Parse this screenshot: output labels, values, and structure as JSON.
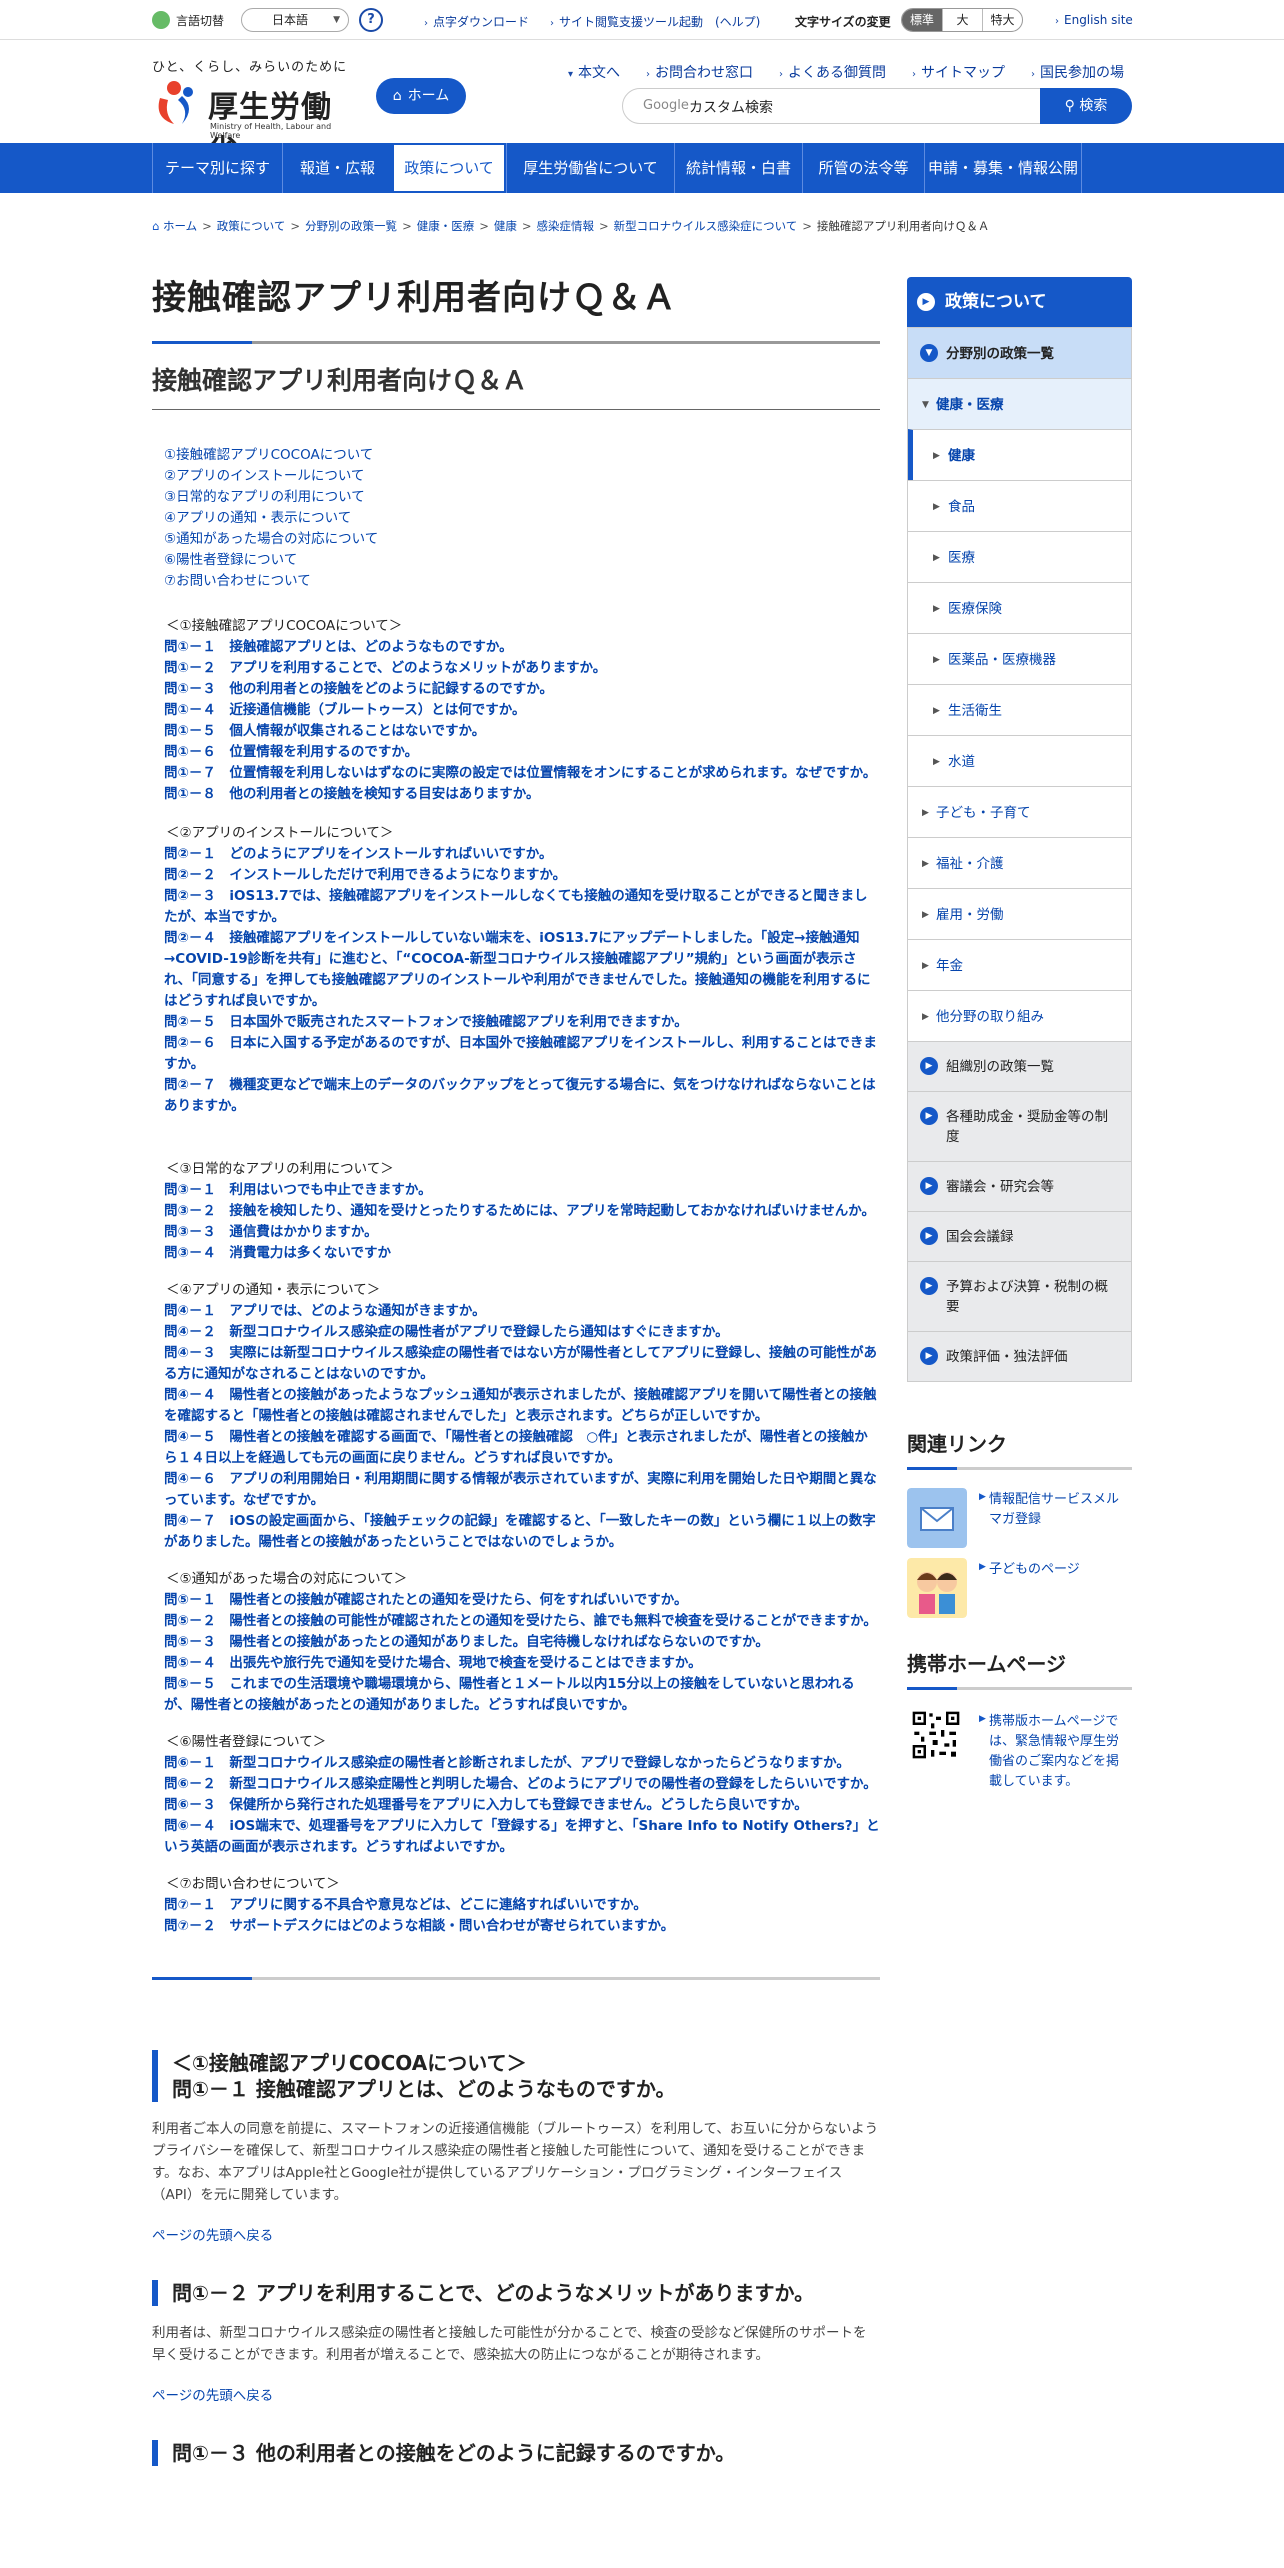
{
  "util": {
    "lang_label": "言語切替",
    "lang_value": "日本語",
    "help": "?",
    "links": [
      "点字ダウンロード",
      "サイト閲覧支援ツール起動　(ヘルプ)"
    ],
    "fontsize_label": "文字サイズの変更",
    "fontsize_options": [
      "標準",
      "大",
      "特大"
    ],
    "english": "English site"
  },
  "header": {
    "tagline": "ひと、くらし、みらいのために",
    "logo_name": "厚生労働省",
    "logo_en": "Ministry of Health, Labour and Welfare",
    "home": "ホーム",
    "links": [
      "本文へ",
      "お問合わせ窓口",
      "よくある御質問",
      "サイトマップ",
      "国民参加の場"
    ],
    "search_placeholder": "カスタム検索",
    "search_brand": "Google",
    "search_button": "検索"
  },
  "gnav": [
    "テーマ別に探す",
    "報道・広報",
    "政策について",
    "厚生労働省について",
    "統計情報・白書",
    "所管の法令等",
    "申請・募集・情報公開"
  ],
  "breadcrumb": [
    "ホーム",
    "政策について",
    "分野別の政策一覧",
    "健康・医療",
    "健康",
    "感染症情報",
    "新型コロナウイルス感染症について",
    "接触確認アプリ利用者向けＱ＆Ａ"
  ],
  "main": {
    "title": "接触確認アプリ利用者向けＱ＆Ａ",
    "subtitle": "接触確認アプリ利用者向けＱ＆Ａ",
    "toc": [
      "①接触確認アプリCOCOAについて",
      "②アプリのインストールについて",
      "③日常的なアプリの利用について",
      "④アプリの通知・表示について",
      "⑤通知があった場合の対応について",
      "⑥陽性者登録について",
      "⑦お問い合わせについて"
    ],
    "sections": [
      {
        "head": "＜①接触確認アプリCOCOAについて＞",
        "qs": [
          "問①－１　接触確認アプリとは、どのようなものですか。",
          "問①－２　アプリを利用することで、どのようなメリットがありますか。",
          "問①－３　他の利用者との接触をどのように記録するのですか。",
          "問①－４　近接通信機能（ブルートゥース）とは何ですか。",
          "問①－５　個人情報が収集されることはないですか。",
          "問①－６　位置情報を利用するのですか。",
          "問①－７　位置情報を利用しないはずなのに実際の設定では位置情報をオンにすることが求められます。なぜですか。",
          "問①－８　他の利用者との接触を検知する目安はありますか。"
        ]
      },
      {
        "head": "＜②アプリのインストールについて＞",
        "qs": [
          "問②－１　どのようにアプリをインストールすればいいですか。",
          "問②－２　インストールしただけで利用できるようになりますか。",
          "問②－３　iOS13.7では、接触確認アプリをインストールしなくても接触の通知を受け取ることができると聞きましたが、本当ですか。",
          "問②－４　接触確認アプリをインストールしていない端末を、iOS13.7にアップデートしました。「設定→接触通知→COVID-19診断を共有」に進むと、「“COCOA-新型コロナウイルス接触確認アプリ”規約」という画面が表示され、「同意する」を押しても接触確認アプリのインストールや利用ができませんでした。接触通知の機能を利用するにはどうすれば良いですか。",
          "問②－５　日本国外で販売されたスマートフォンで接触確認アプリを利用できますか。",
          "問②－６　日本に入国する予定があるのですが、日本国外で接触確認アプリをインストールし、利用することはできますか。",
          "問②－７　機種変更などで端末上のデータのバックアップをとって復元する場合に、気をつけなければならないことはありますか。"
        ]
      },
      {
        "head": "＜③日常的なアプリの利用について＞",
        "qs": [
          "問③－１　利用はいつでも中止できますか。",
          "問③－２　接触を検知したり、通知を受けとったりするためには、アプリを常時起動しておかなければいけませんか。",
          "問③－３　通信費はかかりますか。",
          "問③－４　消費電力は多くないですか"
        ]
      },
      {
        "head": "＜④アプリの通知・表示について＞",
        "qs": [
          "問④－１　アプリでは、どのような通知がきますか。",
          "問④－２　新型コロナウイルス感染症の陽性者がアプリで登録したら通知はすぐにきますか。",
          "問④－３　実際には新型コロナウイルス感染症の陽性者ではない方が陽性者としてアプリに登録し、接触の可能性がある方に通知がなされることはないのですか。",
          "問④－４　陽性者との接触があったようなプッシュ通知が表示されましたが、接触確認アプリを開いて陽性者との接触を確認すると「陽性者との接触は確認されませんでした」と表示されます。どちらが正しいですか。",
          "問④－５　陽性者との接触を確認する画面で、「陽性者との接触確認　○件」と表示されましたが、陽性者との接触から１４日以上を経過しても元の画面に戻りません。どうすれば良いですか。",
          "問④－６　アプリの利用開始日・利用期間に関する情報が表示されていますが、実際に利用を開始した日や期間と異なっています。なぜですか。",
          "問④－７　iOSの設定画面から、「接触チェックの記録」を確認すると、「一致したキーの数」という欄に１以上の数字がありました。陽性者との接触があったということではないのでしょうか。"
        ]
      },
      {
        "head": "＜⑤通知があった場合の対応について＞",
        "qs": [
          "問⑤－１　陽性者との接触が確認されたとの通知を受けたら、何をすればいいですか。",
          "問⑤－２　陽性者との接触の可能性が確認されたとの通知を受けたら、誰でも無料で検査を受けることができますか。",
          "問⑤－３　陽性者との接触があったとの通知がありました。自宅待機しなければならないのですか。",
          "問⑤－４　出張先や旅行先で通知を受けた場合、現地で検査を受けることはできますか。",
          "問⑤－５　これまでの生活環境や職場環境から、陽性者と１メートル以内15分以上の接触をしていないと思われるが、陽性者との接触があったとの通知がありました。どうすれば良いですか。"
        ]
      },
      {
        "head": "＜⑥陽性者登録について＞",
        "qs": [
          "問⑥－１　新型コロナウイルス感染症の陽性者と診断されましたが、アプリで登録しなかったらどうなりますか。",
          "問⑥－２　新型コロナウイルス感染症陽性と判明した場合、どのようにアプリでの陽性者の登録をしたらいいですか。",
          "問⑥－３　保健所から発行された処理番号をアプリに入力しても登録できません。どうしたら良いですか。",
          "問⑥－４　iOS端末で、処理番号をアプリに入力して「登録する」を押すと、「Share Info to Notify Others?」という英語の画面が表示されます。どうすればよいですか。"
        ]
      },
      {
        "head": "＜⑦お問い合わせについて＞",
        "qs": [
          "問⑦－１　アプリに関する不具合や意見などは、どこに連絡すればいいですか。",
          "問⑦－２　サポートデスクにはどのような相談・問い合わせが寄せられていますか。"
        ]
      }
    ],
    "answers": [
      {
        "head1": "＜①接触確認アプリCOCOAについて＞",
        "head2": "問①－１ 接触確認アプリとは、どのようなものですか。",
        "body": "利用者ご本人の同意を前提に、スマートフォンの近接通信機能（ブルートゥース）を利用して、お互いに分からないようプライバシーを確保して、新型コロナウイルス感染症の陽性者と接触した可能性について、通知を受けることができます。なお、本アプリはApple社とGoogle社が提供しているアプリケーション・プログラミング・インターフェイス（API）を元に開発しています。",
        "totop": "ページの先頭へ戻る"
      },
      {
        "head2": "問①－２ アプリを利用することで、どのようなメリットがありますか。",
        "body": "利用者は、新型コロナウイルス感染症の陽性者と接触した可能性が分かることで、検査の受診など保健所のサポートを早く受けることができます。利用者が増えることで、感染拡大の防止につながることが期待されます。",
        "totop": "ページの先頭へ戻る"
      },
      {
        "head2": "問①－３ 他の利用者との接触をどのように記録するのですか。"
      }
    ]
  },
  "sidebar": {
    "title": "政策について",
    "l1_top": "分野別の政策一覧",
    "l2_health": "健康・医療",
    "l3": [
      "健康",
      "食品",
      "医療",
      "医療保険",
      "医薬品・医療機器",
      "生活衛生",
      "水道"
    ],
    "l2_others": [
      "子ども・子育て",
      "福祉・介護",
      "雇用・労働",
      "年金",
      "他分野の取り組み"
    ],
    "l1_bottom": [
      "組織別の政策一覧",
      "各種助成金・奨励金等の制度",
      "審議会・研究会等",
      "国会会議録",
      "予算および決算・税制の概要",
      "政策評価・独法評価"
    ],
    "related_title": "関連リンク",
    "related": [
      "情報配信サービスメルマガ登録",
      "子どものページ"
    ],
    "mobile_title": "携帯ホームページ",
    "mobile_text": "携帯版ホームページでは、緊急情報や厚生労働省のご案内などを掲載しています。"
  },
  "colors": {
    "brand": "#1558c8",
    "link": "#0645ad"
  }
}
